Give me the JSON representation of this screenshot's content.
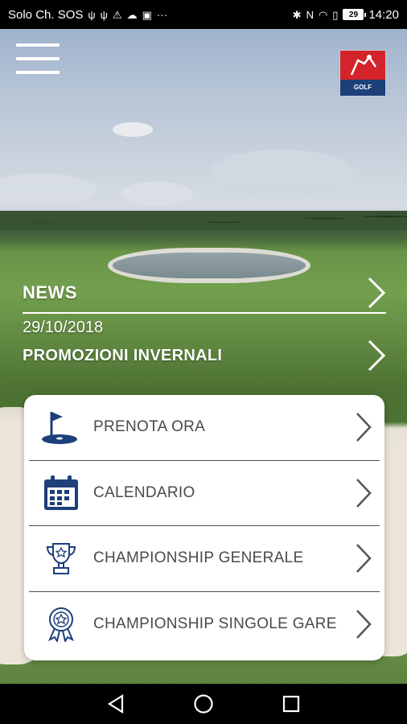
{
  "status_bar": {
    "carrier": "Solo Ch. SOS",
    "left_icons": [
      "usb-icon",
      "usb-icon",
      "warning-icon",
      "cloud-icon",
      "image-icon",
      "more-icon"
    ],
    "right_icons": [
      "bluetooth-icon",
      "nfc-icon",
      "wifi-icon",
      "sim-icon"
    ],
    "battery": "29",
    "time": "14:20"
  },
  "header": {
    "menu_icon": "hamburger-menu-icon",
    "logo_text": "GOLF"
  },
  "news": {
    "section_title": "NEWS",
    "date": "29/10/2018",
    "item_title": "PROMOZIONI INVERNALI"
  },
  "menu": {
    "items": [
      {
        "label": "PRENOTA ORA",
        "icon": "golf-flag-icon"
      },
      {
        "label": "CALENDARIO",
        "icon": "calendar-icon"
      },
      {
        "label": "CHAMPIONSHIP GENERALE",
        "icon": "trophy-icon"
      },
      {
        "label": "CHAMPIONSHIP SINGOLE GARE",
        "icon": "medal-icon"
      }
    ]
  },
  "colors": {
    "accent_blue": "#1d3f7a",
    "logo_red": "#d4232b",
    "chevron_gray": "#555555"
  }
}
